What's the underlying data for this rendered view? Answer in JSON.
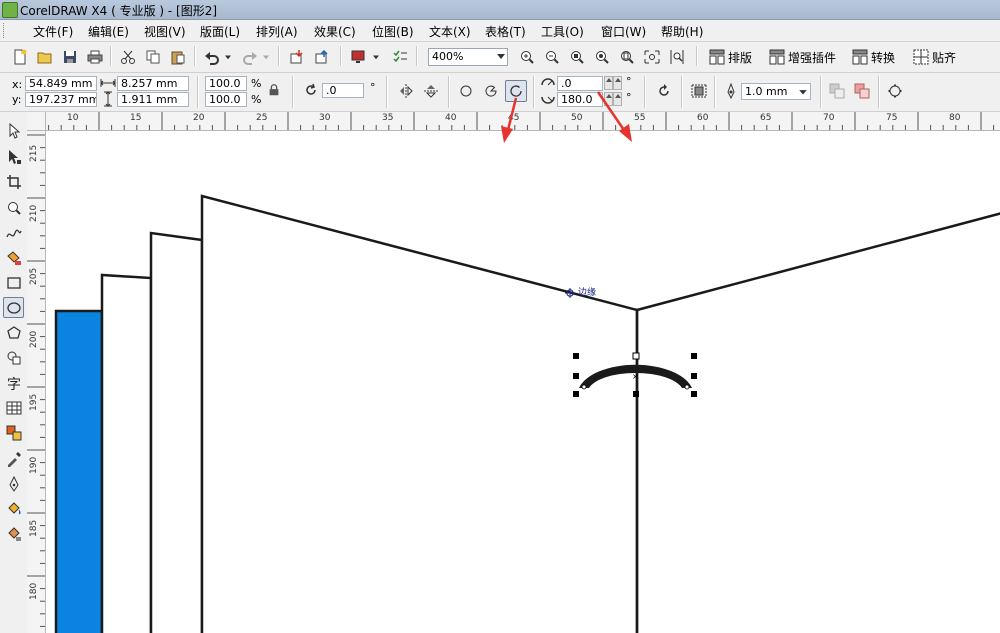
{
  "window": {
    "title": "CorelDRAW X4 ( 专业版 ) - [图形2]"
  },
  "menu": [
    "文件(F)",
    "编辑(E)",
    "视图(V)",
    "版面(L)",
    "排列(A)",
    "效果(C)",
    "位图(B)",
    "文本(X)",
    "表格(T)",
    "工具(O)",
    "窗口(W)",
    "帮助(H)"
  ],
  "toolbar": {
    "zoom_level": "400%",
    "plugins": [
      "排版",
      "增强插件",
      "转换",
      "贴齐"
    ]
  },
  "property_bar": {
    "x_label": "x:",
    "x_value": "54.849 mm",
    "y_label": "y:",
    "y_value": "197.237 mm",
    "width_value": "8.257 mm",
    "height_value": "1.911 mm",
    "scale_x": "100.0",
    "scale_y": "100.0",
    "percent": "%",
    "rotation": ".0",
    "degree": "°",
    "start_angle": ".0",
    "end_angle": "180.0",
    "outline_width": "1.0 mm"
  },
  "rulers": {
    "horizontal_ticks": [
      "10",
      "15",
      "20",
      "25",
      "30",
      "35",
      "40",
      "45",
      "50",
      "55",
      "60",
      "65",
      "70",
      "75",
      "80"
    ],
    "vertical_ticks": [
      "215",
      "210",
      "205",
      "200",
      "195",
      "190",
      "185",
      "180"
    ]
  },
  "canvas": {
    "node_tooltip": "边缘",
    "accent_fill": "#0a84e0",
    "arc_fill": "#1a1a1a",
    "arrow_color": "#e8322e"
  }
}
